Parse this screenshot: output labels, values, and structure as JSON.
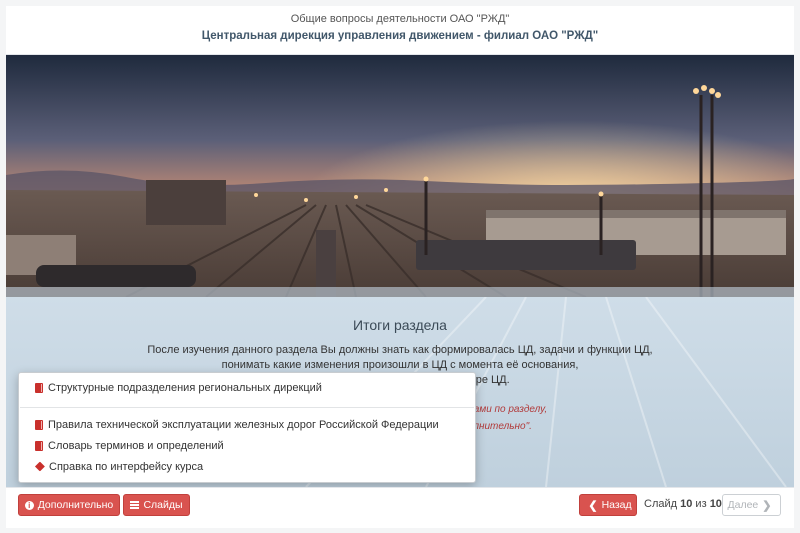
{
  "header": {
    "subtitle": "Общие вопросы деятельности ОАО \"РЖД\"",
    "title": "Центральная дирекция управления движением - филиал ОАО \"РЖД\""
  },
  "hero": {
    "icon": "railway-yard-sunset-image"
  },
  "section": {
    "title": "Итоги раздела",
    "lines": [
      "После изучения данного раздела Вы должны знать как формировалась ЦД, задачи и функции ЦД,",
      "понимать какие изменения произошли в ЦД с момента её основания,",
      "ктуре ЦД."
    ],
    "note_lines": [
      "ериалами по разделу,",
      "олнительно\"."
    ]
  },
  "popup": {
    "items": [
      {
        "label": "Структурные подразделения региональных дирекций",
        "icon": "book-icon"
      },
      {
        "label": "Правила технической эксплуатации железных дорог Российской Федерации",
        "icon": "book-icon"
      },
      {
        "label": "Словарь терминов и определений",
        "icon": "book-icon"
      },
      {
        "label": "Справка по интерфейсу курса",
        "icon": "tag-icon"
      }
    ]
  },
  "footer": {
    "more_label": "Дополнительно",
    "slides_label": "Слайды",
    "back_label": "Назад",
    "slide_prefix": "Слайд",
    "slide_current": "10",
    "slide_sep": "из",
    "slide_total": "10",
    "next_label": "Далее"
  },
  "colors": {
    "accent": "#d9534f",
    "title": "#41576a",
    "content_bg": "#c6d6e2"
  }
}
